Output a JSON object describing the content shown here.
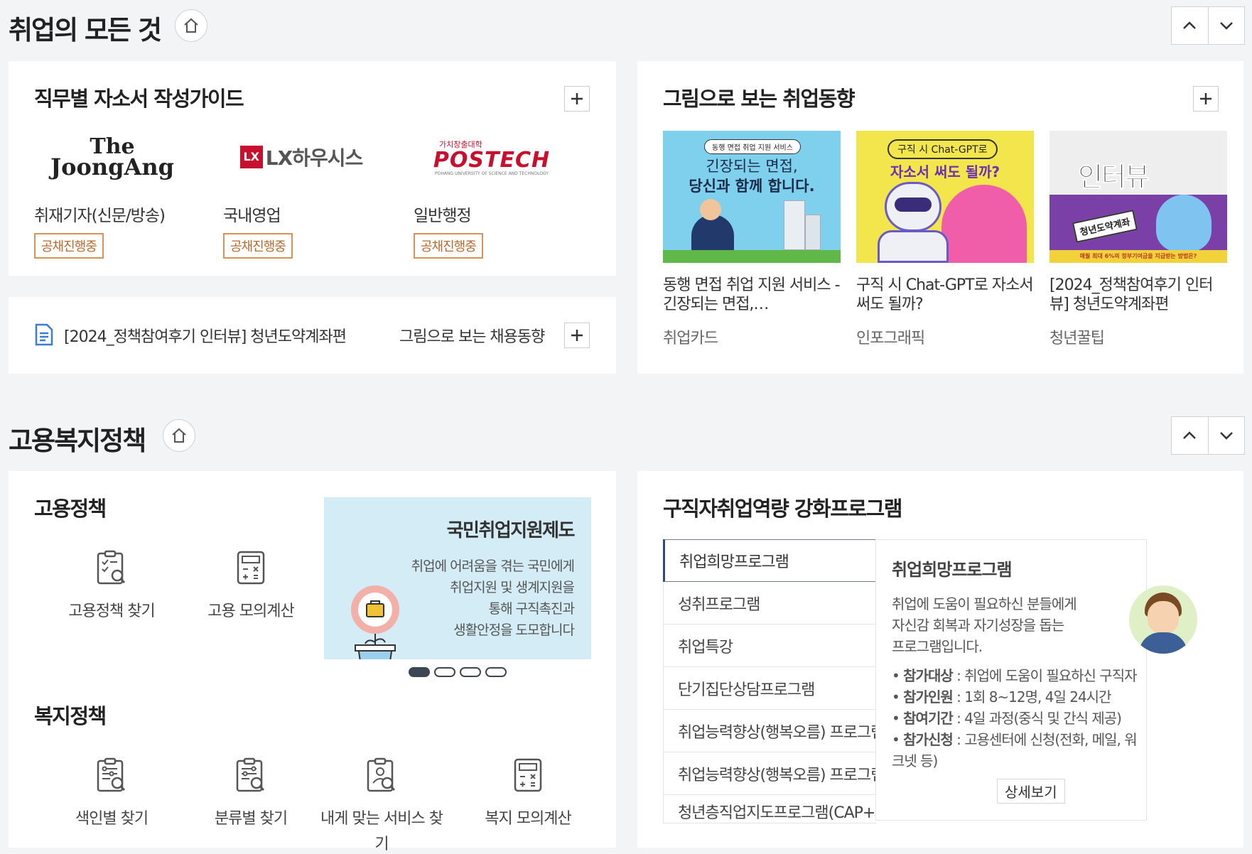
{
  "section1": {
    "title": "취업의 모든 것"
  },
  "guide": {
    "title": "직무별 자소서 작성가이드",
    "items": [
      {
        "logo_line1": "The",
        "logo_line2": "JoongAng",
        "name": "취재기자(신문/방송)",
        "badge": "공채진행중"
      },
      {
        "logo_mark": "LX",
        "logo_text": "LX하우시스",
        "name": "국내영업",
        "badge": "공채진행중"
      },
      {
        "logo_small": "가치창출대학",
        "logo_text": "POSTECH",
        "logo_sub": "POHANG UNIVERSITY OF SCIENCE AND TECHNOLOGY",
        "name": "일반행정",
        "badge": "공채진행중"
      }
    ]
  },
  "notice": {
    "text": "[2024_정책참여후기 인터뷰] 청년도약계좌편",
    "link": "그림으로 보는 채용동향"
  },
  "trends": {
    "title": "그림으로 보는 취업동향",
    "cards": [
      {
        "img_pill": "동행 면접 취업 지원 서비스",
        "img_line1": "긴장되는 면접,",
        "img_line2": "당신과 함께 합니다.",
        "title": "동행 면접 취업 지원 서비스 - 긴장되는 면접,…",
        "category": "취업카드"
      },
      {
        "img_pill": "구직 시 Chat-GPT로",
        "img_line1": "자소서 써도 될까?",
        "title": "구직 시 Chat-GPT로 자소서 써도 될까?",
        "category": "인포그래픽"
      },
      {
        "img_big": "인터뷰",
        "img_sign": "청년도약계좌",
        "img_bottom": "매월 최대 6%의 정부기여금을 지급받는 방법은?",
        "title": "[2024_정책참여후기 인터뷰] 청년도약계좌편",
        "category": "청년꿀팁"
      }
    ]
  },
  "section2": {
    "title": "고용복지정책"
  },
  "policy": {
    "employ_title": "고용정책",
    "employ_items": [
      "고용정책 찾기",
      "고용 모의계산"
    ],
    "welfare_title": "복지정책",
    "welfare_items": [
      "색인별 찾기",
      "분류별 찾기",
      "내게 맞는 서비스 찾기",
      "복지 모의계산"
    ],
    "banner": {
      "title": "국민취업지원제도",
      "lines": [
        "취업에 어려움을 겪는 국민에게",
        "취업지원 및 생계지원을",
        "통해 구직촉진과",
        "생활안정을 도모합니다"
      ]
    }
  },
  "program": {
    "title": "구직자취업역량 강화프로그램",
    "tabs": [
      "취업희망프로그램",
      "성취프로그램",
      "취업특강",
      "단기집단상담프로그램",
      "취업능력향상(행복오름) 프로그램",
      "취업능력향상(행복오름) 프로그램",
      "청년층직업지도프로그램(CAP+)"
    ],
    "detail": {
      "title": "취업희망프로그램",
      "desc": [
        "취업에 도움이 필요하신 분들에게",
        "자신감 회복과 자기성장을 돕는",
        "프로그램입니다."
      ],
      "info": [
        {
          "label": "참가대상",
          "value": "취업에 도움이 필요하신 구직자"
        },
        {
          "label": "참가인원",
          "value": "1회 8~12명, 4일 24시간"
        },
        {
          "label": "참여기간",
          "value": "4일 과정(중식 및 간식 제공)"
        },
        {
          "label": "참가신청",
          "value": "고용센터에 신청(전화, 메일, 워크넷 등)"
        }
      ],
      "more": "상세보기"
    }
  },
  "colors": {
    "accent_navy": "#2c4a7a",
    "badge_orange": "#d89456",
    "banner_bg": "#d3ecf6"
  }
}
